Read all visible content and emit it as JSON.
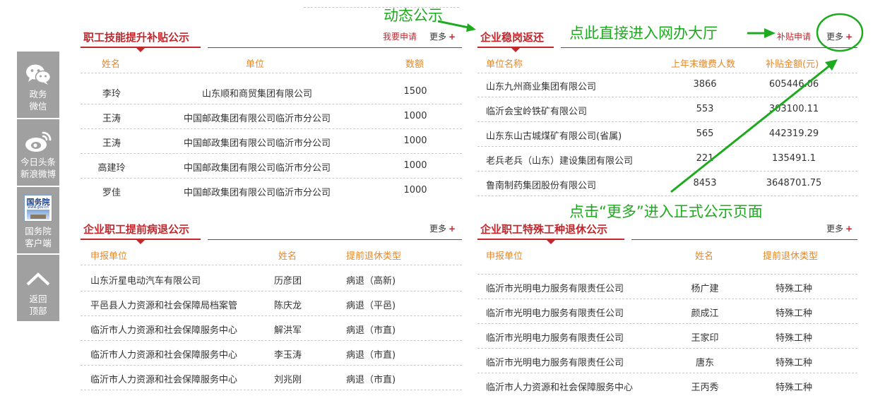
{
  "sidebar": {
    "wechat": "政务\n微信",
    "weibo": "今日头条\n新浪微博",
    "gov_badge": "国务院",
    "gov_badge_sub": "www.gov.cn",
    "gov": "国务院\n客户端",
    "top": "返回\n顶部"
  },
  "skill": {
    "title": "职工技能提升补贴公示",
    "apply": "我要申请",
    "more": "更多",
    "plus": "+",
    "headers": [
      "姓名",
      "单位",
      "数额"
    ],
    "rows": [
      [
        "李玲",
        "山东顺和商贸集团有限公司",
        "1500"
      ],
      [
        "王涛",
        "中国邮政集团有限公司临沂市分公司",
        "1000"
      ],
      [
        "王涛",
        "中国邮政集团有限公司临沂市分公司",
        "1000"
      ],
      [
        "高建玲",
        "中国邮政集团有限公司临沂市分公司",
        "1000"
      ],
      [
        "罗佳",
        "中国邮政集团有限公司临沂市分公司",
        "1000"
      ]
    ]
  },
  "stable": {
    "title": "企业稳岗返还",
    "apply": "补贴申请",
    "more": "更多",
    "plus": "+",
    "headers": [
      "单位名称",
      "上年末缴费人数",
      "补贴金额(元)"
    ],
    "rows": [
      [
        "山东九州商业集团有限公司",
        "3866",
        "605446.06"
      ],
      [
        "临沂会宝岭铁矿有限公司",
        "553",
        "303100.11"
      ],
      [
        "山东东山古城煤矿有限公司(省属)",
        "565",
        "442319.29"
      ],
      [
        "老兵老兵（山东）建设集团有限公司",
        "221",
        "135491.1"
      ],
      [
        "鲁南制药集团股份有限公司",
        "8453",
        "3648701.75"
      ]
    ]
  },
  "illness": {
    "title": "企业职工提前病退公示",
    "more": "更多",
    "plus": "+",
    "headers": [
      "申报单位",
      "姓名",
      "提前退休类型"
    ],
    "rows": [
      [
        "山东沂星电动汽车有限公司",
        "历彦团",
        "病退（高新)"
      ],
      [
        "平邑县人力资源和社会保障局档案管",
        "陈庆龙",
        "病退（平邑)"
      ],
      [
        "临沂市人力资源和社会保障服务中心",
        "解洪军",
        "病退（市直)"
      ],
      [
        "临沂市人力资源和社会保障服务中心",
        "李玉涛",
        "病退（市直)"
      ],
      [
        "临沂市人力资源和社会保障服务中心",
        "刘兆刚",
        "病退（市直)"
      ]
    ]
  },
  "special": {
    "title": "企业职工特殊工种退休公示",
    "more": "更多",
    "plus": "+",
    "headers": [
      "申报单位",
      "姓名",
      "提前退休类型"
    ],
    "rows": [
      [
        "临沂市光明电力服务有限责任公司",
        "杨广建",
        "特殊工种"
      ],
      [
        "临沂市光明电力服务有限责任公司",
        "颜成江",
        "特殊工种"
      ],
      [
        "临沂市光明电力服务有限责任公司",
        "王家印",
        "特殊工种"
      ],
      [
        "临沂市光明电力服务有限责任公司",
        "唐东",
        "特殊工种"
      ],
      [
        "临沂市人力资源和社会保障服务中心",
        "王丙秀",
        "特殊工种"
      ]
    ]
  },
  "annotations": {
    "dynamic": "动态公示",
    "direct": "点此直接进入网办大厅",
    "more_hint": "点击“更多”进入正式公示页面"
  },
  "colors": {
    "accent_red": "#c0282d",
    "header_orange": "#e3892f",
    "annotation_green": "#1eaa1e",
    "sidebar_gray": "#a0a0a0",
    "rule_blue": "#3b5a8a"
  }
}
